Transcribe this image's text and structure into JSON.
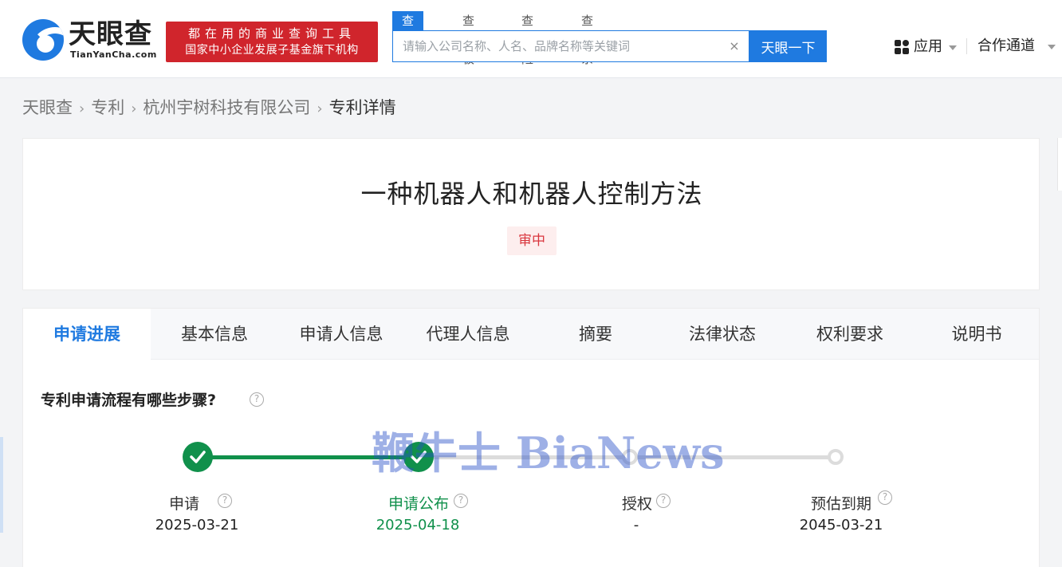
{
  "logo": {
    "cn": "天眼查",
    "en": "TianYanCha.com"
  },
  "banner": {
    "line1": "都在用的商业查询工具",
    "line2": "国家中小企业发展子基金旗下机构"
  },
  "search": {
    "tabs": [
      "查公司",
      "查老板",
      "查风险",
      "查关系"
    ],
    "placeholder": "请输入公司名称、人名、品牌名称等关键词",
    "button": "天眼一下"
  },
  "nav": {
    "apps": "应用",
    "coop": "合作通道"
  },
  "breadcrumb": [
    "天眼查",
    "专利",
    "杭州宇树科技有限公司",
    "专利详情"
  ],
  "patent": {
    "title": "一种机器人和机器人控制方法",
    "status": "审中"
  },
  "tabs": [
    "申请进展",
    "基本信息",
    "申请人信息",
    "代理人信息",
    "摘要",
    "法律状态",
    "权利要求",
    "说明书"
  ],
  "progress": {
    "question": "专利申请流程有哪些步骤?",
    "steps": [
      {
        "label": "申请",
        "date": "2025-03-21",
        "state": "done"
      },
      {
        "label": "申请公布",
        "date": "2025-04-18",
        "state": "done"
      },
      {
        "label": "授权",
        "date": "-",
        "state": "pending"
      },
      {
        "label": "预估到期",
        "date": "2045-03-21",
        "state": "pending"
      }
    ]
  },
  "watermark": "鞭牛士 BiaNews",
  "colors": {
    "brand": "#1f7ae0",
    "banner": "#d0252c",
    "done": "#10904b",
    "status": "#d9363e"
  }
}
